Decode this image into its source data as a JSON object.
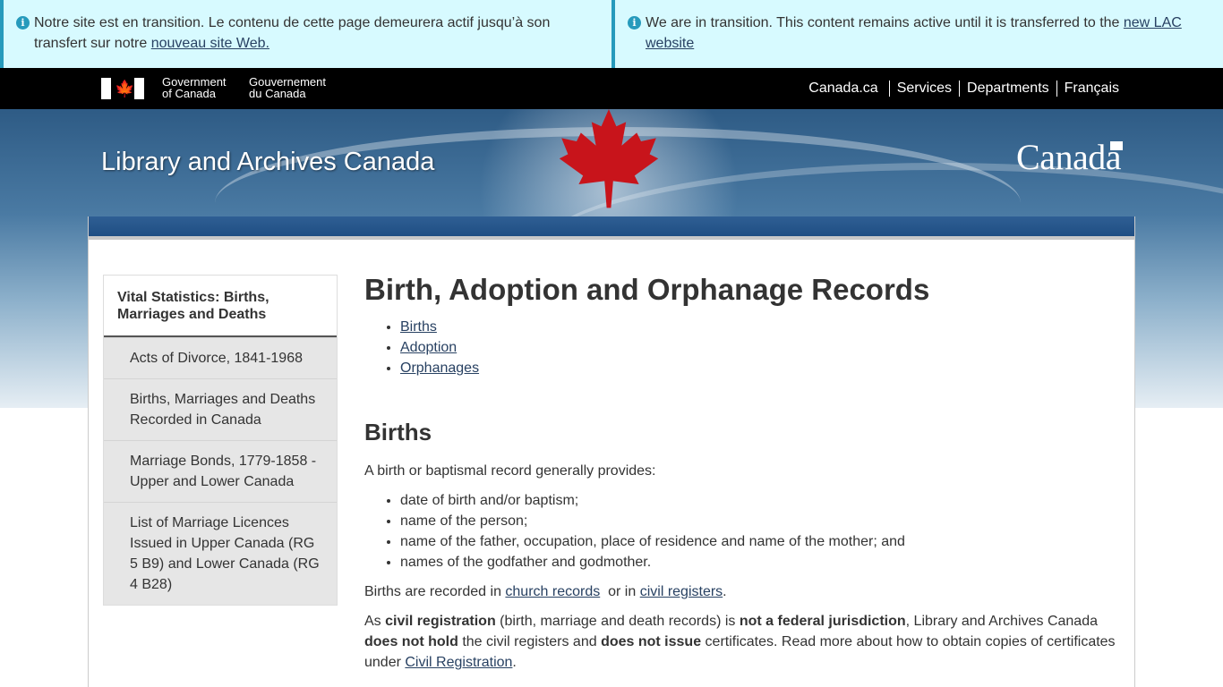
{
  "notices": {
    "fr": {
      "text": "Notre site est en transition. Le contenu de cette page demeurera actif jusqu’à son transfert sur notre ",
      "link": "nouveau site Web."
    },
    "en": {
      "text": "We are in transition. This content remains active until it is transferred to the ",
      "link": "new LAC website"
    }
  },
  "fip": {
    "gov_en_line1": "Government",
    "gov_en_line2": "of Canada",
    "gov_fr_line1": "Gouvernement",
    "gov_fr_line2": "du Canada",
    "menu": [
      "Canada.ca",
      "Services",
      "Departments",
      "Français"
    ]
  },
  "banner": {
    "site_title": "Library and Archives Canada",
    "wordmark": "Canada"
  },
  "sidenav": {
    "heading": "Vital Statistics: Births, Marriages and Deaths",
    "items": [
      "Acts of Divorce, 1841-1968",
      "Births, Marriages and Deaths Recorded in Canada",
      "Marriage Bonds, 1779-1858 - Upper and Lower Canada",
      "List of Marriage Licences Issued in Upper Canada (RG 5 B9) and Lower Canada (RG 4 B28)"
    ]
  },
  "main": {
    "title": "Birth, Adoption and Orphanage Records",
    "toc": [
      "Births",
      "Adoption",
      "Orphanages"
    ],
    "births_heading": "Births",
    "intro": "A birth or baptismal record generally provides:",
    "facts": [
      "date of birth and/or baptism;",
      "name of the person;",
      "name of the father, occupation, place of residence and name of the mother; and",
      "names of the godfather and godmother."
    ],
    "recorded": {
      "pre": "Births are recorded in ",
      "link1": "church records",
      "mid": "  or in ",
      "link2": "civil registers",
      "post": "."
    },
    "civil": {
      "t1": "As ",
      "b1": "civil registration",
      "t2": " (birth, marriage and death records) is ",
      "b2": "not a federal jurisdiction",
      "t3": ", Library and Archives Canada ",
      "b3": "does not hold",
      "t4": " the civil registers and ",
      "b4": "does not issue",
      "t5": " certificates. Read more about how to obtain copies of certificates under ",
      "link": "Civil Registration",
      "t6": "."
    }
  }
}
